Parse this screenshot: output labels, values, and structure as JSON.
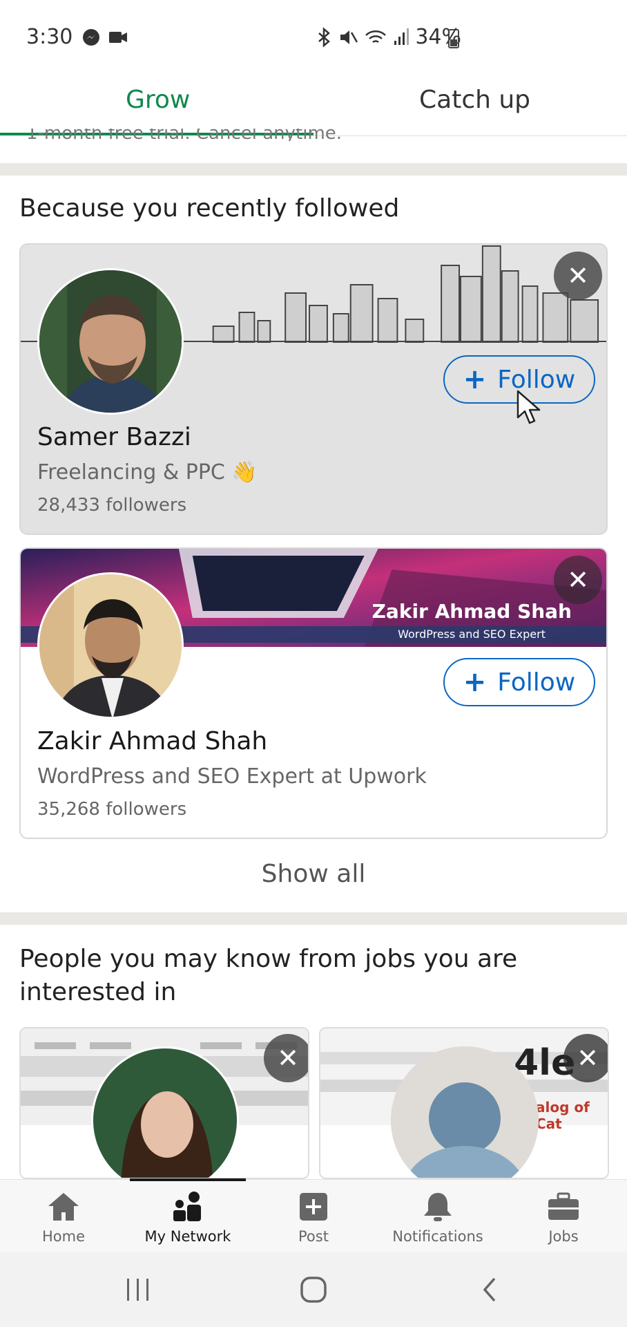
{
  "status_bar": {
    "time": "3:30",
    "battery": "34%"
  },
  "tabs": [
    {
      "label": "Grow",
      "active": true
    },
    {
      "label": "Catch up",
      "active": false
    }
  ],
  "cut_off_text": "1-month free trial. Cancel anytime.",
  "followed_section": {
    "title": "Because you recently followed",
    "cards": [
      {
        "name": "Samer Bazzi",
        "headline": "Freelancing & PPC 👋",
        "followers": "28,433 followers",
        "follow_label": "Follow"
      },
      {
        "name": "Zakir Ahmad Shah",
        "headline": "WordPress and SEO Expert  at Upwork",
        "followers": "35,268 followers",
        "follow_label": "Follow",
        "banner_title": "Zakir Ahmad Shah",
        "banner_subtitle": "WordPress and SEO Expert"
      }
    ],
    "show_all": "Show all"
  },
  "jobs_section": {
    "title": "People you may know from jobs you are interested in",
    "card2_banner_text": "alog of Cat"
  },
  "bottom_nav": [
    {
      "label": "Home",
      "icon": "home-icon"
    },
    {
      "label": "My Network",
      "icon": "network-icon",
      "active": true
    },
    {
      "label": "Post",
      "icon": "post-icon"
    },
    {
      "label": "Notifications",
      "icon": "bell-icon"
    },
    {
      "label": "Jobs",
      "icon": "briefcase-icon"
    }
  ],
  "colors": {
    "accent_green": "#0e8a4b",
    "link_blue": "#0a66c2"
  }
}
